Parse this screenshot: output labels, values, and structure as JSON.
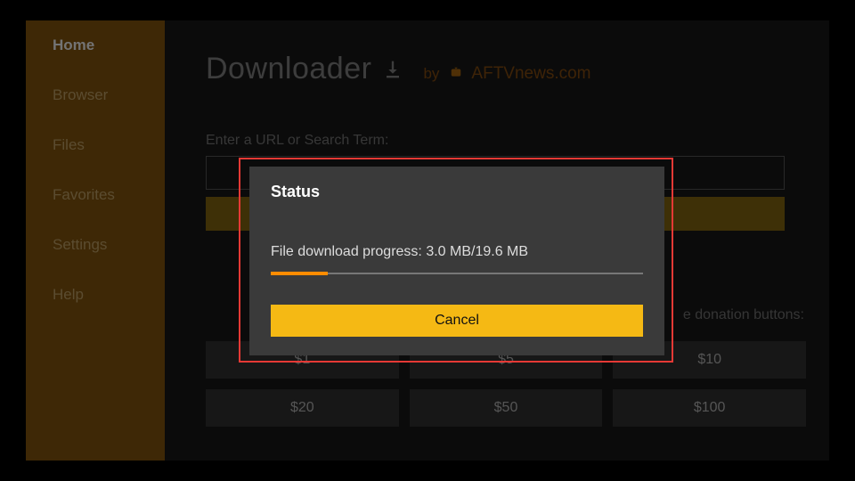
{
  "sidebar": {
    "items": [
      {
        "label": "Home",
        "active": true
      },
      {
        "label": "Browser",
        "active": false
      },
      {
        "label": "Files",
        "active": false
      },
      {
        "label": "Favorites",
        "active": false
      },
      {
        "label": "Settings",
        "active": false
      },
      {
        "label": "Help",
        "active": false
      }
    ]
  },
  "header": {
    "app_title": "Downloader",
    "by": "by",
    "brand": "AFTVnews.com"
  },
  "main": {
    "field_label": "Enter a URL or Search Term:",
    "donation_hint": "e donation buttons:",
    "donation_buttons": [
      "$1",
      "$5",
      "$10",
      "$20",
      "$50",
      "$100"
    ]
  },
  "dialog": {
    "title": "Status",
    "progress_text": "File download progress: 3.0 MB/19.6 MB",
    "progress_percent": 15.3,
    "cancel_label": "Cancel"
  }
}
